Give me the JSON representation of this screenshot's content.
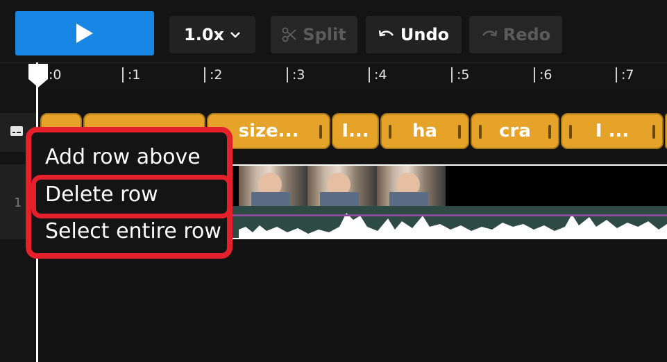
{
  "toolbar": {
    "play_icon": "play-icon",
    "speed_label": "1.0x",
    "split_label": "Split",
    "undo_label": "Undo",
    "redo_label": "Redo"
  },
  "ruler": {
    "ticks": [
      ":0",
      ":1",
      ":2",
      ":3",
      ":4",
      ":5",
      ":6",
      ":7"
    ]
  },
  "captions": [
    "",
    "",
    "size...",
    "I...",
    "ha",
    "cra",
    "I ..."
  ],
  "row_number": "1",
  "context_menu": {
    "items": [
      "Add row above",
      "Delete row",
      "Select entire row"
    ]
  },
  "colors": {
    "accent": "#1886e4",
    "caption": "#e5a32a",
    "highlight": "#e3202b"
  }
}
